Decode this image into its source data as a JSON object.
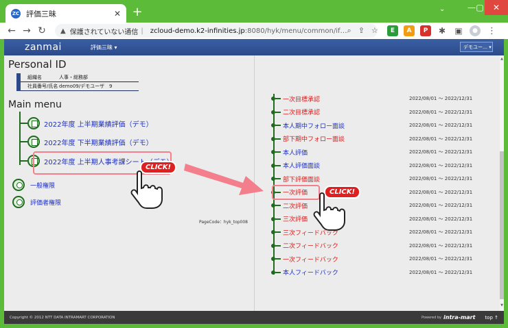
{
  "browser": {
    "tab_title": "評価三昧",
    "favicon_text": "ZC",
    "not_secure_text": "保護されていない通信",
    "url_host": "zcloud-demo.k2-infinities.jp",
    "url_rest": ":8080/hyk/menu/common/if…"
  },
  "header": {
    "logo": "zanmai",
    "app_menu": "評価三昧 ▾",
    "user_menu": "デモユー… ▾"
  },
  "personal": {
    "title": "Personal ID",
    "rows": [
      {
        "label": "組織名",
        "value": "人事・総務部"
      },
      {
        "label": "社員番号/氏名",
        "value": "demo09/デモユーザ　9"
      }
    ]
  },
  "main_menu": {
    "title": "Main menu",
    "items": [
      "2022年度 上半期業績評価（デモ）",
      "2022年度 下半期業績評価（デモ）",
      "2022年度 上半期人事考課シート（デモ）"
    ],
    "perms": [
      "一般権限",
      "評価者権限"
    ]
  },
  "pagecode": "PageCode：hyk_top008",
  "tasks": [
    {
      "label": "一次目標承認",
      "date": "2022/08/01 ～ 2022/12/31",
      "color": "red"
    },
    {
      "label": "二次目標承認",
      "date": "2022/08/01 ～ 2022/12/31",
      "color": "red"
    },
    {
      "label": "本人期中フォロー面談",
      "date": "2022/08/01 ～ 2022/12/31",
      "color": "blue"
    },
    {
      "label": "部下期中フォロー面談",
      "date": "2022/08/01 ～ 2022/12/31",
      "color": "red"
    },
    {
      "label": "本人評価",
      "date": "2022/08/01 ～ 2022/12/31",
      "color": "blue"
    },
    {
      "label": "本人評価面談",
      "date": "2022/08/01 ～ 2022/12/31",
      "color": "blue"
    },
    {
      "label": "部下評価面談",
      "date": "2022/08/01 ～ 2022/12/31",
      "color": "red"
    },
    {
      "label": "一次評価",
      "date": "2022/08/01 ～ 2022/12/31",
      "color": "red"
    },
    {
      "label": "二次評価",
      "date": "2022/08/01 ～ 2022/12/31",
      "color": "red"
    },
    {
      "label": "三次評価",
      "date": "2022/08/01 ～ 2022/12/31",
      "color": "red"
    },
    {
      "label": "三次フィードバック",
      "date": "2022/08/01 ～ 2022/12/31",
      "color": "red"
    },
    {
      "label": "二次フィードバック",
      "date": "2022/08/01 ～ 2022/12/31",
      "color": "red"
    },
    {
      "label": "一次フィードバック",
      "date": "2022/08/01 ～ 2022/12/31",
      "color": "red"
    },
    {
      "label": "本人フィードバック",
      "date": "2022/08/01 ～ 2022/12/31",
      "color": "blue"
    }
  ],
  "callouts": {
    "click_text": "CLICK!"
  },
  "footer": {
    "copyright": "Copyright © 2012 NTT DATA INTRAMART CORPORATION",
    "powered": "Powered by",
    "logo": "intra-mart",
    "top": "top ↑"
  },
  "colors": {
    "accent": "#2c4a8a",
    "chrome": "#5dbb3a",
    "red": "#d91a1a",
    "blue": "#1d2fbf"
  }
}
